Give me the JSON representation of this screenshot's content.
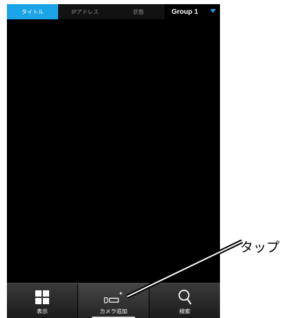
{
  "tabs": [
    {
      "label": "タイトル",
      "active": true
    },
    {
      "label": "IPアドレス",
      "active": false
    },
    {
      "label": "状態",
      "active": false
    }
  ],
  "group_selector": {
    "label": "Group 1",
    "icon": "dropdown-triangle-icon"
  },
  "bottom_bar": {
    "buttons": [
      {
        "label": "表示",
        "icon": "grid-icon",
        "selected": false
      },
      {
        "label": "カメラ追加",
        "icon": "add-camera-icon",
        "selected": true
      },
      {
        "label": "検索",
        "icon": "search-icon",
        "selected": false
      }
    ]
  },
  "annotation": {
    "label": "タップ"
  },
  "colors": {
    "accent": "#1aa3e6",
    "background": "#000000"
  }
}
